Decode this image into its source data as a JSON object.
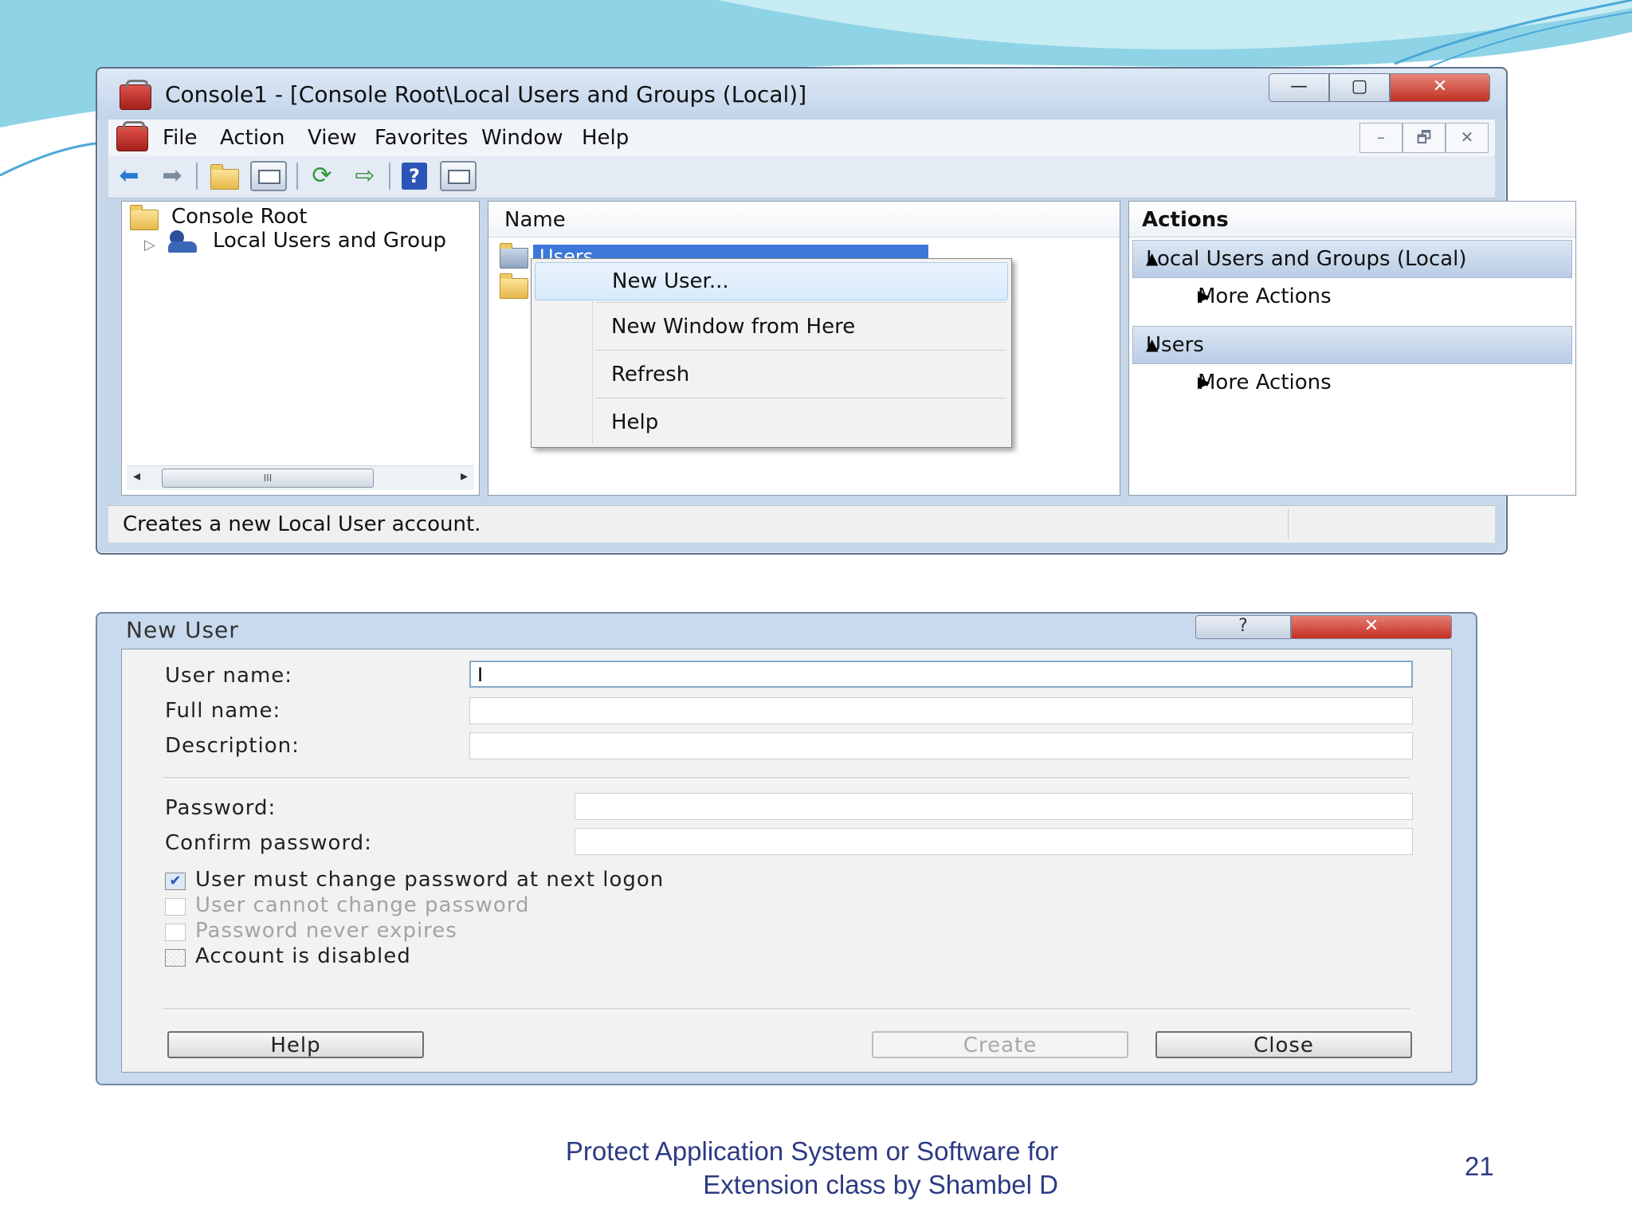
{
  "mmc": {
    "title": "Console1 - [Console Root\\Local Users and Groups (Local)]",
    "caption_buttons": {
      "minimize": "—",
      "maximize": "▢",
      "close": "✕"
    },
    "menu": [
      "File",
      "Action",
      "View",
      "Favorites",
      "Window",
      "Help"
    ],
    "mdi_buttons": {
      "minimize": "–",
      "restore": "🗗",
      "close": "✕"
    },
    "toolbar_icons": [
      "back-arrow-icon",
      "forward-arrow-icon",
      "up-folder-icon",
      "show-hide-console-tree-icon",
      "refresh-icon",
      "export-list-icon",
      "help-icon",
      "show-hide-action-pane-icon"
    ],
    "tree": {
      "root": "Console Root",
      "child": "Local Users and Group",
      "scroll_glyph": "III"
    },
    "list": {
      "column_name": "Name",
      "selected_item": "Users"
    },
    "context_menu": [
      "New User...",
      "New Window from Here",
      "Refresh",
      "Help"
    ],
    "actions": {
      "header": "Actions",
      "groups": [
        {
          "title": "Local Users and Groups (Local)",
          "item": "More Actions"
        },
        {
          "title": "Users",
          "item": "More Actions"
        }
      ]
    },
    "status_text": "Creates a new Local User account."
  },
  "dialog": {
    "title": "New User",
    "help_glyph": "?",
    "close_glyph": "✕",
    "labels": {
      "user_name": "User name:",
      "full_name": "Full name:",
      "description": "Description:",
      "password": "Password:",
      "confirm_password": "Confirm password:"
    },
    "values": {
      "user_name": "I",
      "full_name": "",
      "description": "",
      "password": "",
      "confirm_password": ""
    },
    "checkboxes": [
      {
        "label": "User must change password at next logon",
        "checked": true,
        "enabled": true
      },
      {
        "label": "User cannot change password",
        "checked": false,
        "enabled": false
      },
      {
        "label": "Password never expires",
        "checked": false,
        "enabled": false
      },
      {
        "label": "Account is disabled",
        "checked": false,
        "enabled": true
      }
    ],
    "buttons": {
      "help": "Help",
      "create": "Create",
      "close": "Close"
    }
  },
  "footer": {
    "line1": "Protect Application System or Software for",
    "line2": "Extension class by Shambel D",
    "page_number": "21"
  },
  "colors": {
    "accent_blue": "#3c78d8",
    "footer_text": "#2d3a84",
    "close_red": "#c42e21"
  }
}
